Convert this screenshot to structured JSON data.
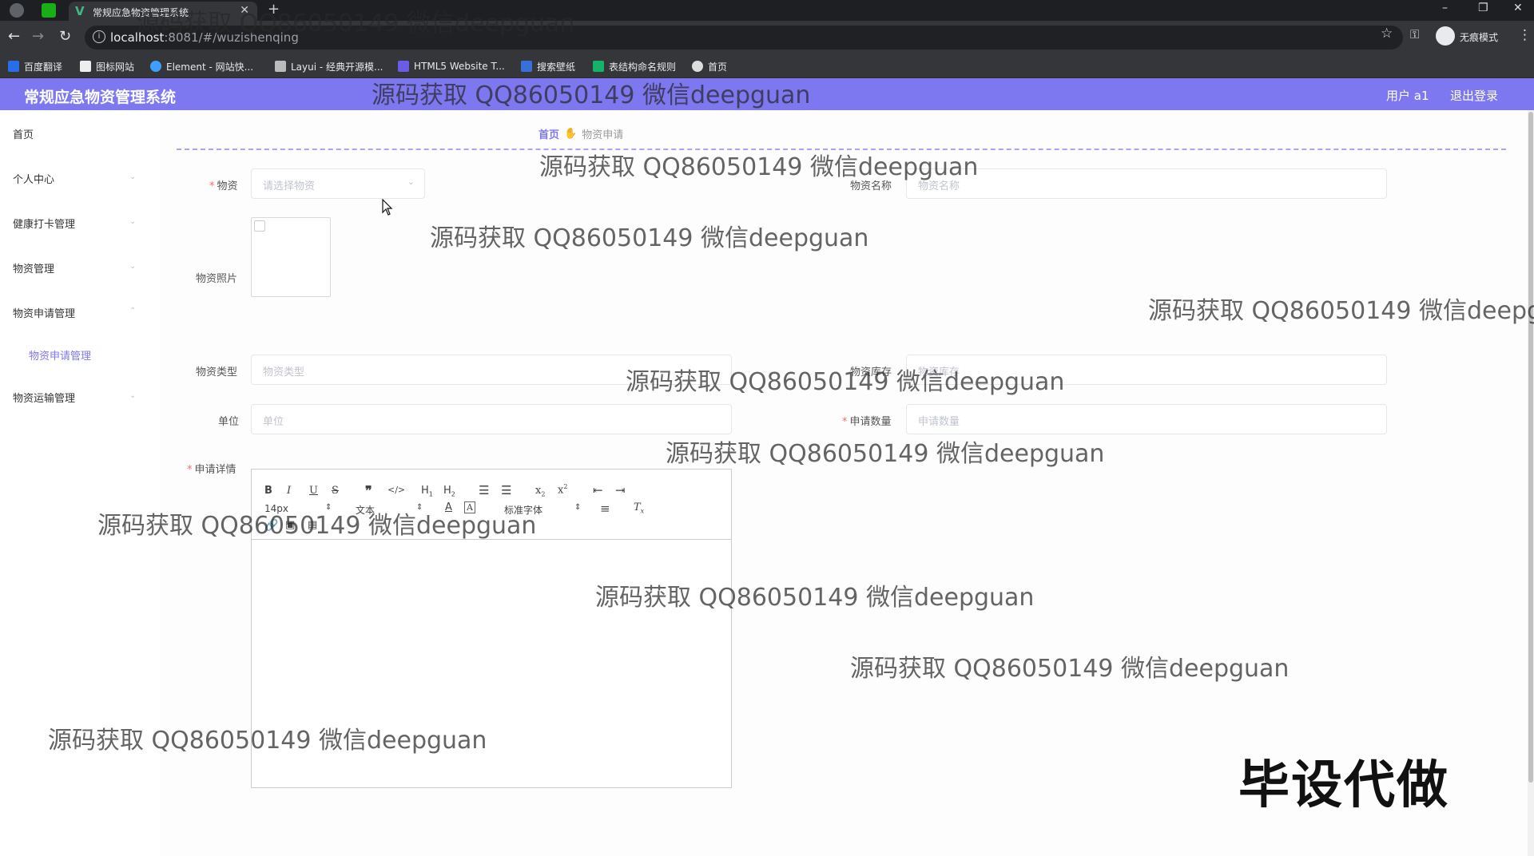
{
  "browser": {
    "tab_title": "常规应急物资管理系统",
    "url_host": "localhost",
    "url_path": ":8081/#/wuzishenqing",
    "incognito_label": "无痕模式",
    "bookmarks": [
      "百度翻译",
      "图标网站",
      "Element - 网站快...",
      "Layui - 经典开源模...",
      "HTML5 Website T...",
      "搜索壁纸",
      "表结构命名规则",
      "首页"
    ]
  },
  "header": {
    "title": "常规应急物资管理系统",
    "user": "用户 a1",
    "logout": "退出登录"
  },
  "sidebar": {
    "items": [
      {
        "label": "首页"
      },
      {
        "label": "个人中心"
      },
      {
        "label": "健康打卡管理"
      },
      {
        "label": "物资管理"
      },
      {
        "label": "物资申请管理"
      },
      {
        "label": "物资申请管理"
      },
      {
        "label": "物资运输管理"
      }
    ]
  },
  "breadcrumb": {
    "home": "首页",
    "current": "物资申请"
  },
  "form": {
    "wuzi_label": "物资",
    "wuzi_placeholder": "请选择物资",
    "name_label": "物资名称",
    "name_placeholder": "物资名称",
    "photo_label": "物资照片",
    "type_label": "物资类型",
    "type_placeholder": "物资类型",
    "stock_label": "物资库存",
    "stock_placeholder": "物资库存",
    "unit_label": "单位",
    "unit_placeholder": "单位",
    "qty_label": "申请数量",
    "qty_placeholder": "申请数量",
    "detail_label": "申请详情"
  },
  "editor": {
    "size": "14px",
    "format": "文本",
    "font": "标准字体"
  },
  "overlay": {
    "watermark": "源码获取 QQ86050149 微信deepguan",
    "watermark_cut": "源码获取 QQ86050149 微信deepg",
    "stamp": "毕设代做"
  }
}
